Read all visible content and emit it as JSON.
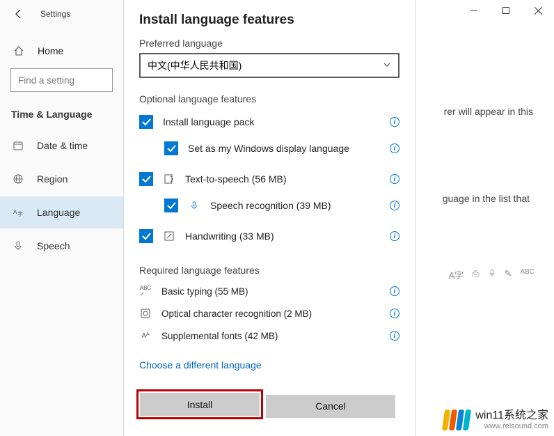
{
  "window": {
    "title": "Settings"
  },
  "sidebar": {
    "home": "Home",
    "search_placeholder": "Find a setting",
    "category": "Time & Language",
    "items": [
      {
        "label": "Date & time",
        "icon": "calendar-icon"
      },
      {
        "label": "Region",
        "icon": "globe-icon"
      },
      {
        "label": "Language",
        "icon": "language-icon"
      },
      {
        "label": "Speech",
        "icon": "mic-icon"
      }
    ]
  },
  "behind": {
    "text1_a": "rer will appear in this",
    "text2_a": "guage in the list that"
  },
  "dialog": {
    "title": "Install language features",
    "preferred_label": "Preferred language",
    "preferred_value": "中文(中华人民共和国)",
    "optional_label": "Optional language features",
    "optional": [
      {
        "label": "Install language pack",
        "indent": false,
        "icon": null
      },
      {
        "label": "Set as my Windows display language",
        "indent": true,
        "icon": null
      },
      {
        "label": "Text-to-speech (56 MB)",
        "indent": false,
        "icon": "tts-icon"
      },
      {
        "label": "Speech recognition (39 MB)",
        "indent": true,
        "icon": "mic-icon"
      },
      {
        "label": "Handwriting (33 MB)",
        "indent": false,
        "icon": "pen-icon"
      }
    ],
    "required_label": "Required language features",
    "required": [
      {
        "label": "Basic typing (55 MB)",
        "icon": "abc-icon"
      },
      {
        "label": "Optical character recognition (2 MB)",
        "icon": "ocr-icon"
      },
      {
        "label": "Supplemental fonts (42 MB)",
        "icon": "font-icon"
      }
    ],
    "choose_different": "Choose a different language",
    "install_btn": "Install",
    "cancel_btn": "Cancel"
  },
  "watermark": {
    "line1": "win11系统之家",
    "line2": "www.relsound.com",
    "logo_colors": [
      "#f0b400",
      "#f05a00",
      "#0a84d6",
      "#00b5c9"
    ]
  }
}
